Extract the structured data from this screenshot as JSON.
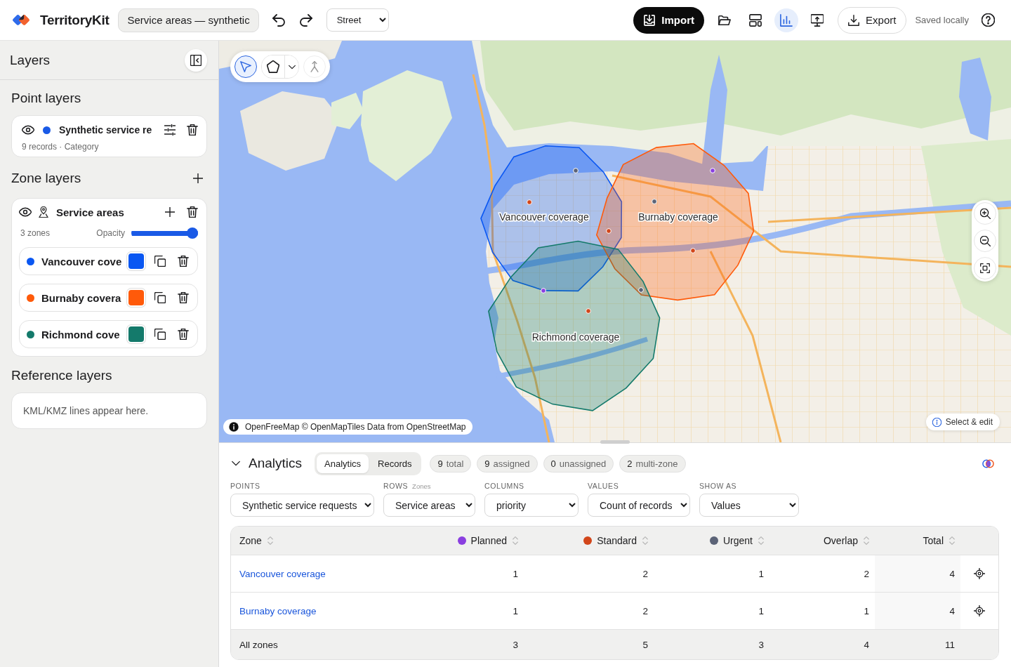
{
  "app": {
    "name": "TerritoryKit",
    "project": "Service areas — synthetic",
    "basemap": "Street"
  },
  "toolbar": {
    "import": "Import",
    "tools": [
      {
        "kind": "open",
        "selected": false
      },
      {
        "kind": "layout",
        "selected": false
      },
      {
        "kind": "analytics",
        "selected": true
      },
      {
        "kind": "present",
        "selected": false
      }
    ],
    "export": "Export",
    "save_status": "Saved locally"
  },
  "sidebar": {
    "title": "Layers",
    "point_heading": "Point layers",
    "point_layers": [
      {
        "name": "Synthetic service re",
        "color": "#1a5ae6",
        "summary": "9 records · Category"
      }
    ],
    "zone_heading": "Zone layers",
    "zone_groups": [
      {
        "name": "Service areas",
        "count": "3 zones",
        "opacity_label": "Opacity",
        "level": 1,
        "zones": [
          {
            "name": "Vancouver cove",
            "color": "#0a57f2"
          },
          {
            "name": "Burnaby covera",
            "color": "#ff5a0a"
          },
          {
            "name": "Richmond cove",
            "color": "#147a6b"
          }
        ]
      }
    ],
    "reference_heading": "Reference layers",
    "reference_empty": "KML/KMZ lines appear here."
  },
  "map": {
    "draw_tools": [
      {
        "kind": "select",
        "selected": true,
        "disabled": false
      },
      {
        "kind": "polygon",
        "selected": false,
        "disabled": false
      },
      {
        "kind": "merge",
        "selected": false,
        "disabled": true
      }
    ],
    "zone_labels": [
      "Vancouver coverage",
      "Burnaby coverage",
      "Richmond coverage"
    ],
    "attribution": "OpenFreeMap © OpenMapTiles Data from OpenStreetMap",
    "mode_hint": "Select & edit"
  },
  "analytics": {
    "title": "Analytics",
    "expanded": true,
    "views": [
      {
        "label": "Analytics",
        "selected": true
      },
      {
        "label": "Records",
        "selected": false
      }
    ],
    "stats": [
      {
        "value": "9",
        "label": "total"
      },
      {
        "value": "9",
        "label": "assigned"
      },
      {
        "value": "0",
        "label": "unassigned"
      },
      {
        "value": "2",
        "label": "multi-zone"
      }
    ],
    "filters": [
      {
        "label": "POINTS",
        "value": "Synthetic service requests"
      },
      {
        "label": "ROWS",
        "hint": "Zones",
        "value": "Service areas"
      },
      {
        "label": "COLUMNS",
        "value": "priority"
      },
      {
        "label": "VALUES",
        "value": "Count of records"
      },
      {
        "label": "SHOW AS",
        "value": "Values"
      }
    ],
    "table": {
      "columns": [
        {
          "label": "Zone"
        },
        {
          "label": "Planned",
          "color": "#8a3fe0"
        },
        {
          "label": "Standard",
          "color": "#d2461a"
        },
        {
          "label": "Urgent",
          "color": "#5b6377"
        },
        {
          "label": "Overlap"
        },
        {
          "label": "Total"
        }
      ],
      "rows": [
        {
          "zone": "Vancouver coverage",
          "cells": [
            "1",
            "2",
            "1",
            "2",
            "4"
          ]
        },
        {
          "zone": "Burnaby coverage",
          "cells": [
            "1",
            "2",
            "1",
            "1",
            "4"
          ]
        }
      ],
      "footer": {
        "label": "All zones",
        "cells": [
          "3",
          "5",
          "3",
          "4",
          "11"
        ]
      }
    }
  }
}
